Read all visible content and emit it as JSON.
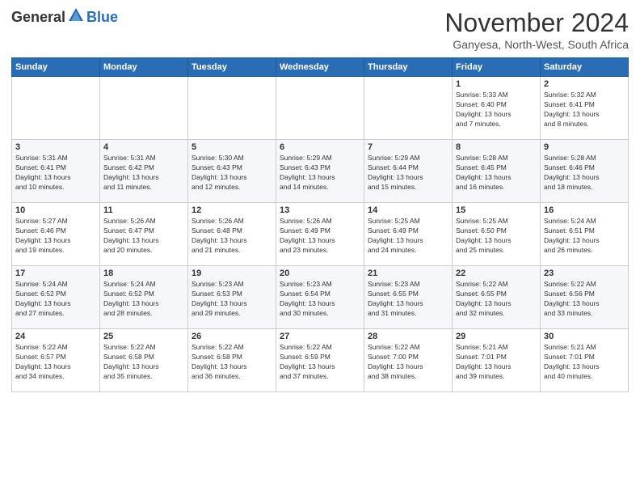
{
  "header": {
    "logo_general": "General",
    "logo_blue": "Blue",
    "month_title": "November 2024",
    "location": "Ganyesa, North-West, South Africa"
  },
  "days_of_week": [
    "Sunday",
    "Monday",
    "Tuesday",
    "Wednesday",
    "Thursday",
    "Friday",
    "Saturday"
  ],
  "weeks": [
    {
      "days": [
        {
          "num": "",
          "info": ""
        },
        {
          "num": "",
          "info": ""
        },
        {
          "num": "",
          "info": ""
        },
        {
          "num": "",
          "info": ""
        },
        {
          "num": "",
          "info": ""
        },
        {
          "num": "1",
          "info": "Sunrise: 5:33 AM\nSunset: 6:40 PM\nDaylight: 13 hours\nand 7 minutes."
        },
        {
          "num": "2",
          "info": "Sunrise: 5:32 AM\nSunset: 6:41 PM\nDaylight: 13 hours\nand 8 minutes."
        }
      ]
    },
    {
      "days": [
        {
          "num": "3",
          "info": "Sunrise: 5:31 AM\nSunset: 6:41 PM\nDaylight: 13 hours\nand 10 minutes."
        },
        {
          "num": "4",
          "info": "Sunrise: 5:31 AM\nSunset: 6:42 PM\nDaylight: 13 hours\nand 11 minutes."
        },
        {
          "num": "5",
          "info": "Sunrise: 5:30 AM\nSunset: 6:43 PM\nDaylight: 13 hours\nand 12 minutes."
        },
        {
          "num": "6",
          "info": "Sunrise: 5:29 AM\nSunset: 6:43 PM\nDaylight: 13 hours\nand 14 minutes."
        },
        {
          "num": "7",
          "info": "Sunrise: 5:29 AM\nSunset: 6:44 PM\nDaylight: 13 hours\nand 15 minutes."
        },
        {
          "num": "8",
          "info": "Sunrise: 5:28 AM\nSunset: 6:45 PM\nDaylight: 13 hours\nand 16 minutes."
        },
        {
          "num": "9",
          "info": "Sunrise: 5:28 AM\nSunset: 6:46 PM\nDaylight: 13 hours\nand 18 minutes."
        }
      ]
    },
    {
      "days": [
        {
          "num": "10",
          "info": "Sunrise: 5:27 AM\nSunset: 6:46 PM\nDaylight: 13 hours\nand 19 minutes."
        },
        {
          "num": "11",
          "info": "Sunrise: 5:26 AM\nSunset: 6:47 PM\nDaylight: 13 hours\nand 20 minutes."
        },
        {
          "num": "12",
          "info": "Sunrise: 5:26 AM\nSunset: 6:48 PM\nDaylight: 13 hours\nand 21 minutes."
        },
        {
          "num": "13",
          "info": "Sunrise: 5:26 AM\nSunset: 6:49 PM\nDaylight: 13 hours\nand 23 minutes."
        },
        {
          "num": "14",
          "info": "Sunrise: 5:25 AM\nSunset: 6:49 PM\nDaylight: 13 hours\nand 24 minutes."
        },
        {
          "num": "15",
          "info": "Sunrise: 5:25 AM\nSunset: 6:50 PM\nDaylight: 13 hours\nand 25 minutes."
        },
        {
          "num": "16",
          "info": "Sunrise: 5:24 AM\nSunset: 6:51 PM\nDaylight: 13 hours\nand 26 minutes."
        }
      ]
    },
    {
      "days": [
        {
          "num": "17",
          "info": "Sunrise: 5:24 AM\nSunset: 6:52 PM\nDaylight: 13 hours\nand 27 minutes."
        },
        {
          "num": "18",
          "info": "Sunrise: 5:24 AM\nSunset: 6:52 PM\nDaylight: 13 hours\nand 28 minutes."
        },
        {
          "num": "19",
          "info": "Sunrise: 5:23 AM\nSunset: 6:53 PM\nDaylight: 13 hours\nand 29 minutes."
        },
        {
          "num": "20",
          "info": "Sunrise: 5:23 AM\nSunset: 6:54 PM\nDaylight: 13 hours\nand 30 minutes."
        },
        {
          "num": "21",
          "info": "Sunrise: 5:23 AM\nSunset: 6:55 PM\nDaylight: 13 hours\nand 31 minutes."
        },
        {
          "num": "22",
          "info": "Sunrise: 5:22 AM\nSunset: 6:55 PM\nDaylight: 13 hours\nand 32 minutes."
        },
        {
          "num": "23",
          "info": "Sunrise: 5:22 AM\nSunset: 6:56 PM\nDaylight: 13 hours\nand 33 minutes."
        }
      ]
    },
    {
      "days": [
        {
          "num": "24",
          "info": "Sunrise: 5:22 AM\nSunset: 6:57 PM\nDaylight: 13 hours\nand 34 minutes."
        },
        {
          "num": "25",
          "info": "Sunrise: 5:22 AM\nSunset: 6:58 PM\nDaylight: 13 hours\nand 35 minutes."
        },
        {
          "num": "26",
          "info": "Sunrise: 5:22 AM\nSunset: 6:58 PM\nDaylight: 13 hours\nand 36 minutes."
        },
        {
          "num": "27",
          "info": "Sunrise: 5:22 AM\nSunset: 6:59 PM\nDaylight: 13 hours\nand 37 minutes."
        },
        {
          "num": "28",
          "info": "Sunrise: 5:22 AM\nSunset: 7:00 PM\nDaylight: 13 hours\nand 38 minutes."
        },
        {
          "num": "29",
          "info": "Sunrise: 5:21 AM\nSunset: 7:01 PM\nDaylight: 13 hours\nand 39 minutes."
        },
        {
          "num": "30",
          "info": "Sunrise: 5:21 AM\nSunset: 7:01 PM\nDaylight: 13 hours\nand 40 minutes."
        }
      ]
    }
  ]
}
